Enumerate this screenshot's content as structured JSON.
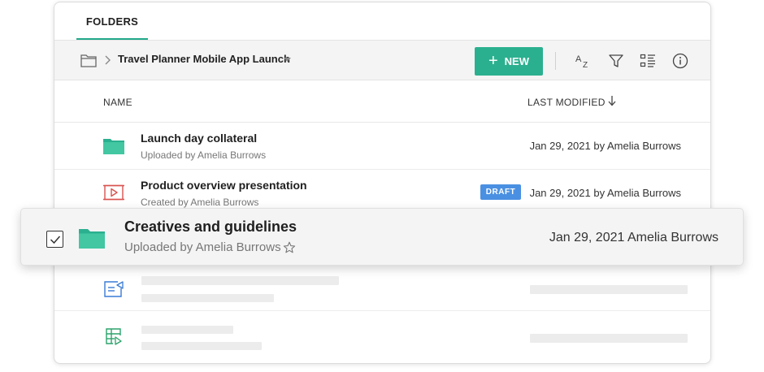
{
  "tabs": [
    {
      "label": "FOLDERS",
      "active": true
    }
  ],
  "toolbar": {
    "breadcrumb_title": "Travel Planner Mobile App Launch",
    "new_button_label": "NEW",
    "accent_color": "#2bb08f",
    "icons": [
      "folder-icon",
      "chevron-right-icon",
      "caret-down-icon",
      "sort-az-icon",
      "filter-icon",
      "view-list-icon",
      "info-icon"
    ]
  },
  "table": {
    "columns": {
      "name": "NAME",
      "last_modified": "LAST MODIFIED"
    },
    "sort_icon": "arrow-down-icon",
    "rows": [
      {
        "title": "Launch day collateral",
        "subtitle": "Uploaded by Amelia Burrows",
        "modified": "Jan 29, 2021 by Amelia Burrows",
        "icon": "folder-icon"
      },
      {
        "title": "Product overview presentation",
        "subtitle": "Created by Amelia Burrows",
        "modified": "Jan 29, 2021 by Amelia Burrows",
        "icon": "presentation-icon",
        "badge": "DRAFT",
        "badge_color": "#4a90e2"
      }
    ],
    "placeholder_rows": [
      {
        "icon": "document-share-icon"
      },
      {
        "icon": "spreadsheet-icon"
      }
    ]
  },
  "floating_row": {
    "title": "Creatives and guidelines",
    "subtitle": "Uploaded by Amelia Burrows",
    "modified": "Jan 29, 2021 Amelia Burrows",
    "checked": true,
    "icons": [
      "checkbox-icon",
      "folder-icon",
      "star-icon"
    ]
  }
}
